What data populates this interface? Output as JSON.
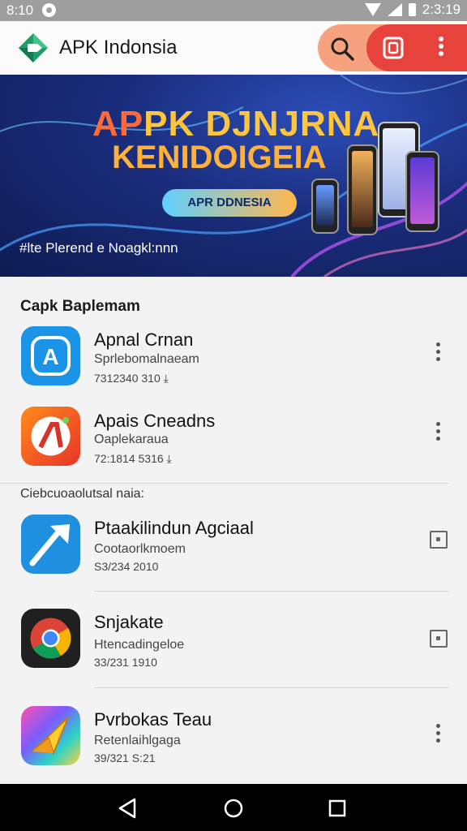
{
  "status_bar": {
    "time": "8:10",
    "right_time": "2:3:19"
  },
  "app_bar": {
    "title": "APK Indonsia"
  },
  "banner": {
    "title_line1_a": "AP",
    "title_line1_b": "PK DJNJRNA",
    "title_line2": "KENIDOIGEIA",
    "chip": "APR DDNESIA",
    "tagline": "#lte Plerend e Noagkl:nnn"
  },
  "sections": {
    "top": "Capk Baplemam",
    "middle": "Ciebcuoaolutsal naia:"
  },
  "apps": [
    {
      "name": "Apnal Crnan",
      "sub": "Sprlebomalnaeam",
      "meta": "7312340 310",
      "icon": "blue-a-app-icon",
      "action": "more-vert-icon"
    },
    {
      "name": "Apais Cneadns",
      "sub": "Oaplekaraua",
      "meta": "72:1814 5316",
      "icon": "orange-a-app-icon",
      "action": "more-vert-icon"
    },
    {
      "name": "Ptaakilindun Agciaal",
      "sub": "Cootaorlkmoem",
      "meta": "S3/234 2010",
      "icon": "blue-arrow-app-icon",
      "action": "square-icon"
    },
    {
      "name": "Snjakate",
      "sub": "Htencadingeloe",
      "meta": "33/231 1910",
      "icon": "chrome-app-icon",
      "action": "square-icon"
    },
    {
      "name": "Pvrbokas Teau",
      "sub": "Retenlaihlgaga",
      "meta": "39/321 S:21",
      "icon": "rainbow-plane-app-icon",
      "action": "more-vert-icon"
    }
  ],
  "colors": {
    "accent_orange": "#f7a27e",
    "accent_red": "#e8423d",
    "banner_blue": "#1a2d7c",
    "logo_green": "#1f9e6b"
  }
}
